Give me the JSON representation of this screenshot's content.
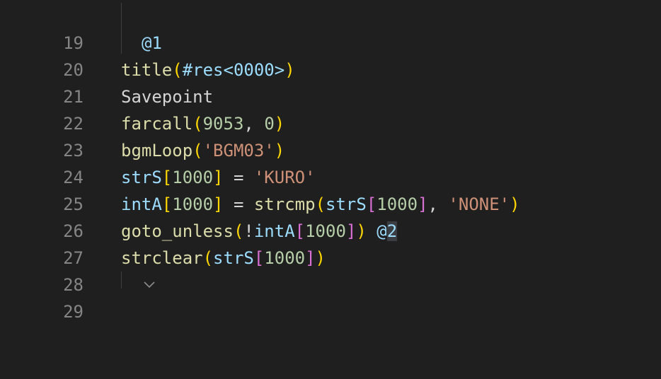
{
  "lines": [
    {
      "n": "19"
    },
    {
      "n": "20",
      "label": "@1"
    },
    {
      "n": "21",
      "fn": "title",
      "open": "(",
      "arg": "#res<0000>",
      "close": ")"
    },
    {
      "n": "22",
      "text": "Savepoint"
    },
    {
      "n": "23",
      "fn": "farcall",
      "open": "(",
      "a1": "9053",
      "sep": ", ",
      "a2": "0",
      "close": ")"
    },
    {
      "n": "24",
      "fn": "bgmLoop",
      "open": "(",
      "str": "'BGM03'",
      "close": ")"
    },
    {
      "n": "25",
      "var": "strS",
      "open": "[",
      "idx": "1000",
      "close": "]",
      "op": " = ",
      "str": "'KURO'"
    },
    {
      "n": "26",
      "var": "intA",
      "open": "[",
      "idx": "1000",
      "close": "]",
      "op": " = ",
      "fn": "strcmp",
      "open2": "(",
      "var2": "strS",
      "open3": "[",
      "idx2": "1000",
      "close3": "]",
      "sep": ", ",
      "str": "'NONE'",
      "close2": ")"
    },
    {
      "n": "27",
      "fn": "goto_unless",
      "open": "(",
      "not": "!",
      "var": "intA",
      "open2": "[",
      "idx": "1000",
      "close2": "]",
      "close": ")",
      "sp": " ",
      "label_at": "@",
      "label_num": "2"
    },
    {
      "n": "28",
      "fn": "strclear",
      "open": "(",
      "var": "strS",
      "open2": "[",
      "idx": "1000",
      "close2": "]",
      "close": ")"
    },
    {
      "n": "29"
    }
  ]
}
